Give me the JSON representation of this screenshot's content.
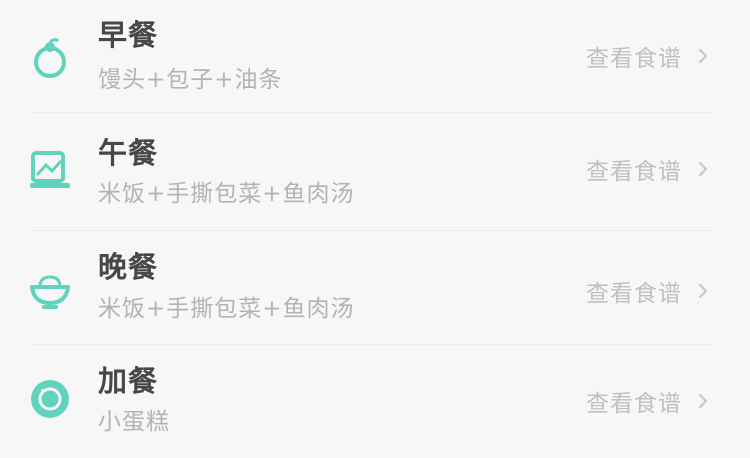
{
  "meals": [
    {
      "title": "早餐",
      "desc": "馒头+包子+油条",
      "action": "查看食谱",
      "icon": "apple-icon"
    },
    {
      "title": "午餐",
      "desc": "米饭+手撕包菜+鱼肉汤",
      "action": "查看食谱",
      "icon": "lunch-box-icon"
    },
    {
      "title": "晚餐",
      "desc": "米饭+手撕包菜+鱼肉汤",
      "action": "查看食谱",
      "icon": "bowl-icon"
    },
    {
      "title": "加餐",
      "desc": "小蛋糕",
      "action": "查看食谱",
      "icon": "cookie-icon"
    }
  ],
  "colors": {
    "accent": "#5fd3bd",
    "title": "#474747",
    "subtitle": "#b3b3b3",
    "action": "#c0c0c0",
    "background": "#f7f7f7"
  }
}
